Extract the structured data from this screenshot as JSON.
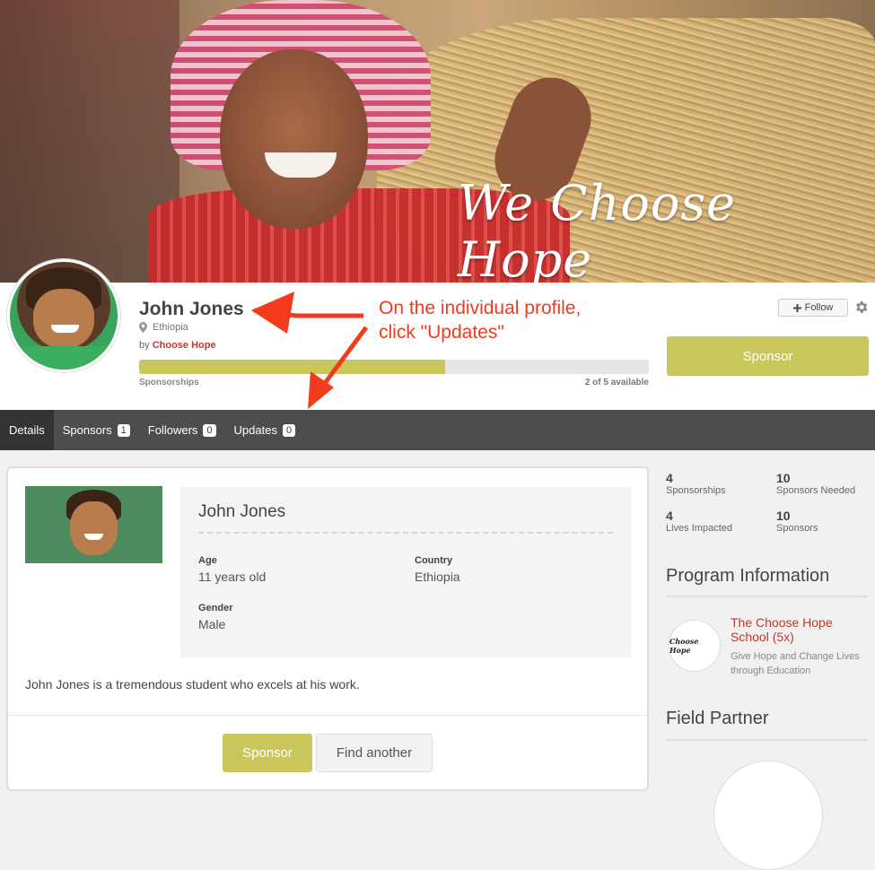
{
  "banner": {
    "tagline": "We Choose Hope"
  },
  "profile": {
    "name": "John Jones",
    "location": "Ethiopia",
    "by_prefix": "by",
    "organization": "Choose Hope",
    "sponsorships_label": "Sponsorships",
    "sponsorships_count": "2 of 5 available",
    "sponsorship_progress": 0.6,
    "follow_label": "Follow",
    "sponsor_label": "Sponsor"
  },
  "annotation": {
    "line1": "On the individual profile,",
    "line2": "click \"Updates\"",
    "color": "#f23b1c"
  },
  "tabs": [
    {
      "label": "Details",
      "badge": null
    },
    {
      "label": "Sponsors",
      "badge": "1"
    },
    {
      "label": "Followers",
      "badge": "0"
    },
    {
      "label": "Updates",
      "badge": "0"
    }
  ],
  "details": {
    "name": "John Jones",
    "age_label": "Age",
    "age_value": "11 years old",
    "country_label": "Country",
    "country_value": "Ethiopia",
    "gender_label": "Gender",
    "gender_value": "Male",
    "description": "John Jones is a tremendous student who excels at his work.",
    "sponsor_button": "Sponsor",
    "find_button": "Find another"
  },
  "stats": [
    {
      "num": "4",
      "label": "Sponsorships"
    },
    {
      "num": "10",
      "label": "Sponsors Needed"
    },
    {
      "num": "4",
      "label": "Lives Impacted"
    },
    {
      "num": "10",
      "label": "Sponsors"
    }
  ],
  "program": {
    "heading": "Program Information",
    "logo_text": "Choose Hope",
    "name": "The Choose Hope School (5x)",
    "tagline": "Give Hope and Change Lives through Education"
  },
  "partner": {
    "heading": "Field Partner"
  },
  "colors": {
    "accent": "#c9c75b",
    "link": "#c0392b",
    "tabbar": "#4d4d4d"
  }
}
